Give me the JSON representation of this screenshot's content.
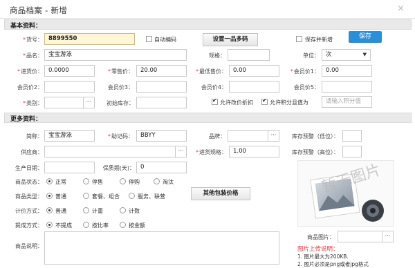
{
  "dialog": {
    "title": "商品档案 - 新增",
    "close": "×"
  },
  "sections": {
    "basic": "基本资料：",
    "more": "更多资料："
  },
  "fields": {
    "code": {
      "label": "货号：",
      "value": "8899550"
    },
    "auto_code": "自动编码",
    "multi_code_btn": "设置一品多码",
    "save_and_new": "保存并新增",
    "save_btn": "保存",
    "name": {
      "label": "品名：",
      "value": "宝宝游泳"
    },
    "spec": {
      "label": "规格：",
      "value": ""
    },
    "unit": {
      "label": "单位：",
      "value": "次"
    },
    "purchase_price": {
      "label": "进货价：",
      "value": "0.0000"
    },
    "retail_price": {
      "label": "零售价：",
      "value": "20.00"
    },
    "min_price": {
      "label": "最低售价：",
      "value": "0.00"
    },
    "member_price1": {
      "label": "会员价1：",
      "value": "0.00"
    },
    "member_price2": {
      "label": "会员价2：",
      "value": ""
    },
    "member_price3": {
      "label": "会员价3：",
      "value": ""
    },
    "member_price4": {
      "label": "会员价4：",
      "value": ""
    },
    "member_price5": {
      "label": "会员价5：",
      "value": ""
    },
    "category": {
      "label": "类别：",
      "value": "",
      "btn": "···"
    },
    "initial_stock": {
      "label": "初始库存：",
      "value": ""
    },
    "allow_discount": "允许改价折扣",
    "allow_points": "允许积分且值为",
    "points_placeholder": "请输入积分值",
    "short_name": {
      "label": "简称：",
      "value": "宝宝游泳"
    },
    "mnemonic": {
      "label": "助记码：",
      "value": "BBYY"
    },
    "brand": {
      "label": "品牌：",
      "value": "",
      "btn": "···"
    },
    "stock_low": {
      "label": "库存预警（低位）：",
      "value": ""
    },
    "supplier": {
      "label": "供应商：",
      "value": "",
      "btn": "···"
    },
    "purchase_spec": {
      "label": "进货规格：",
      "value": "1.00"
    },
    "stock_high": {
      "label": "库存预警（高位）：",
      "value": ""
    },
    "production_date": {
      "label": "生产日期：",
      "value": ""
    },
    "shelf_life": {
      "label": "保质期(天)：",
      "value": "0"
    },
    "status": {
      "label": "商品状态：",
      "options": [
        "正常",
        "停售",
        "停购",
        "淘汰"
      ],
      "selected": 0
    },
    "type": {
      "label": "商品类型：",
      "options": [
        "普通",
        "套餐、组合",
        "服务、联营"
      ],
      "selected": 0
    },
    "pricing": {
      "label": "计价方式：",
      "options": [
        "普通",
        "计重",
        "计数"
      ],
      "selected": 0
    },
    "commission": {
      "label": "提成方式：",
      "options": [
        "不提成",
        "按比率",
        "按金额"
      ],
      "selected": 0
    },
    "description": {
      "label": "商品说明：",
      "value": ""
    },
    "package_price_btn": "其他包装价格",
    "image": {
      "label": "商品图片：",
      "value": "",
      "btn": "···",
      "watermark": "暂无图片"
    },
    "upload_note": {
      "title": "图片上传说明：",
      "lines": [
        "1. 图片最大为200KB.",
        "2. 图片必须是png或者jpg格式"
      ]
    }
  },
  "colors": {
    "accent": "#2a8fd8",
    "required": "#e03c3c",
    "highlight": "#fdf6d8"
  }
}
